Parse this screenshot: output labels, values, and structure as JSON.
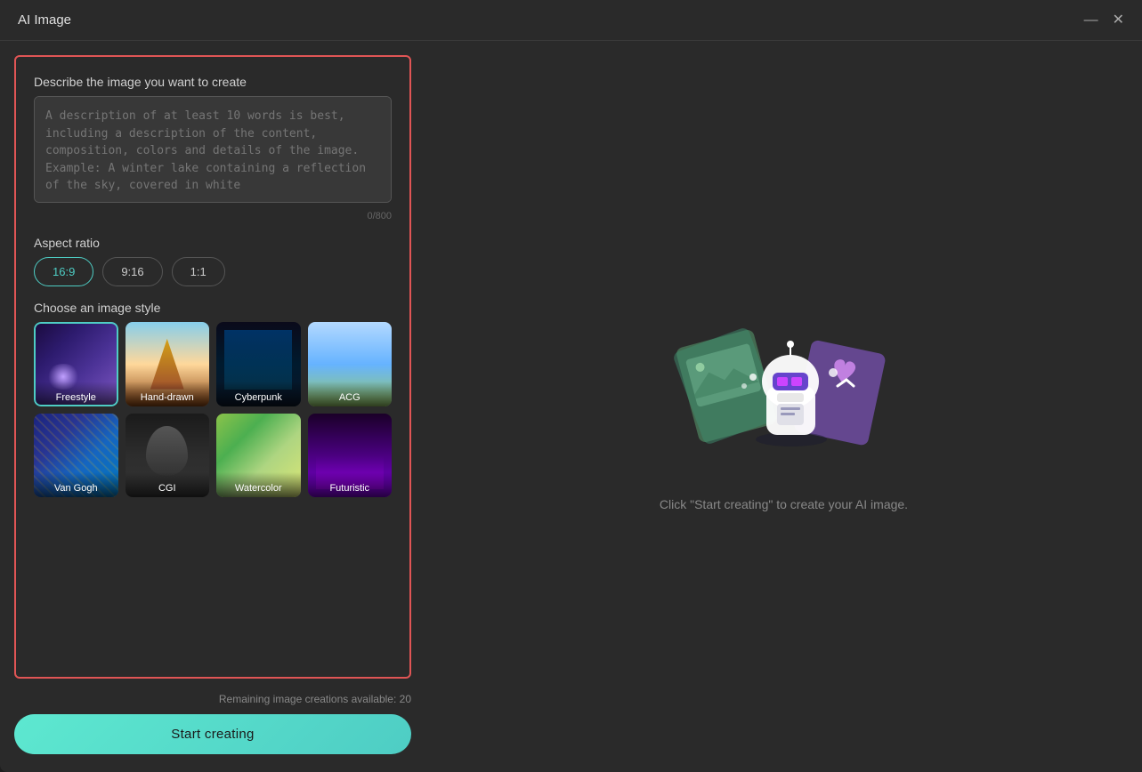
{
  "window": {
    "title": "AI Image"
  },
  "titlebar": {
    "minimize_icon": "—",
    "close_icon": "✕"
  },
  "left": {
    "describe_label": "Describe the image you want to create",
    "textarea_placeholder": "A description of at least 10 words is best, including a description of the content, composition, colors and details of the image. Example: A winter lake containing a reflection of the sky, covered in white",
    "textarea_value": "",
    "char_count": "0/800",
    "aspect_label": "Aspect ratio",
    "aspect_options": [
      {
        "label": "16:9",
        "active": true
      },
      {
        "label": "9:16",
        "active": false
      },
      {
        "label": "1:1",
        "active": false
      }
    ],
    "style_label": "Choose an image style",
    "styles": [
      {
        "id": "freestyle",
        "label": "Freestyle",
        "selected": true,
        "thumb_class": "thumb-freestyle"
      },
      {
        "id": "handdrawn",
        "label": "Hand-drawn",
        "selected": false,
        "thumb_class": "thumb-handdrawn"
      },
      {
        "id": "cyberpunk",
        "label": "Cyberpunk",
        "selected": false,
        "thumb_class": "thumb-cyberpunk"
      },
      {
        "id": "acg",
        "label": "ACG",
        "selected": false,
        "thumb_class": "thumb-acg"
      },
      {
        "id": "vangogh",
        "label": "Van Gogh",
        "selected": false,
        "thumb_class": "thumb-vangogh"
      },
      {
        "id": "cgi",
        "label": "CGI",
        "selected": false,
        "thumb_class": "thumb-cgi"
      },
      {
        "id": "watercolor",
        "label": "Watercolor",
        "selected": false,
        "thumb_class": "thumb-watercolor"
      },
      {
        "id": "futuristic",
        "label": "Futuristic",
        "selected": false,
        "thumb_class": "thumb-futuristic"
      }
    ]
  },
  "bottom": {
    "remaining_text": "Remaining image creations available: 20",
    "start_button": "Start creating"
  },
  "right": {
    "hint": "Click \"Start creating\" to create your AI image."
  }
}
